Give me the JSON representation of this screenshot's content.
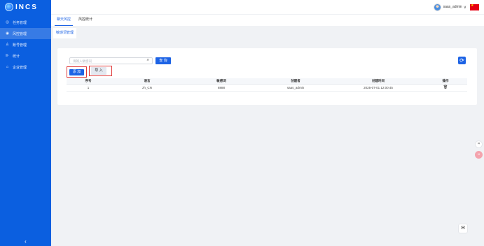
{
  "app": {
    "logo_text": "INCS"
  },
  "sidebar": {
    "items": [
      {
        "label": "任务管理",
        "icon": "task-icon",
        "glyph": "◎"
      },
      {
        "label": "风控管理",
        "icon": "risk-icon",
        "glyph": "◉"
      },
      {
        "label": "账号管理",
        "icon": "user-icon",
        "glyph": "♙"
      },
      {
        "label": "统计",
        "icon": "chart-icon",
        "glyph": "⊪"
      },
      {
        "label": "企业管理",
        "icon": "company-icon",
        "glyph": "⌂"
      }
    ],
    "active_index": 1,
    "collapse_glyph": "‹"
  },
  "header": {
    "username": "saas_admin",
    "chevron": "∨"
  },
  "tabs": [
    {
      "label": "聊天风控",
      "active": true
    },
    {
      "label": "风控统计",
      "active": false
    }
  ],
  "subtab": {
    "label": "敏感词管理"
  },
  "toolbar": {
    "search_placeholder": "请输入敏感词",
    "search_value": "",
    "query_label": "查 询",
    "add_label": "添 加",
    "import_label": "导 入",
    "refresh_glyph": "⟳"
  },
  "table": {
    "columns": [
      "序号",
      "语言",
      "敏感词",
      "创建者",
      "创建时间",
      "操作"
    ],
    "rows": [
      {
        "index": "1",
        "language": "zh_CN",
        "word": "8888",
        "creator": "saas_admin",
        "created_at": "2025-07-01 12:00:45",
        "action_icon": "trash-icon",
        "action_glyph": "🗑"
      }
    ]
  },
  "floating": {
    "tool1_glyph": "⌗",
    "tool2_glyph": "☺",
    "mail_glyph": "✉"
  },
  "colors": {
    "primary": "#1d63e5",
    "sidebar_bg": "#0b5fe0",
    "highlight_border": "#e03a3a"
  }
}
